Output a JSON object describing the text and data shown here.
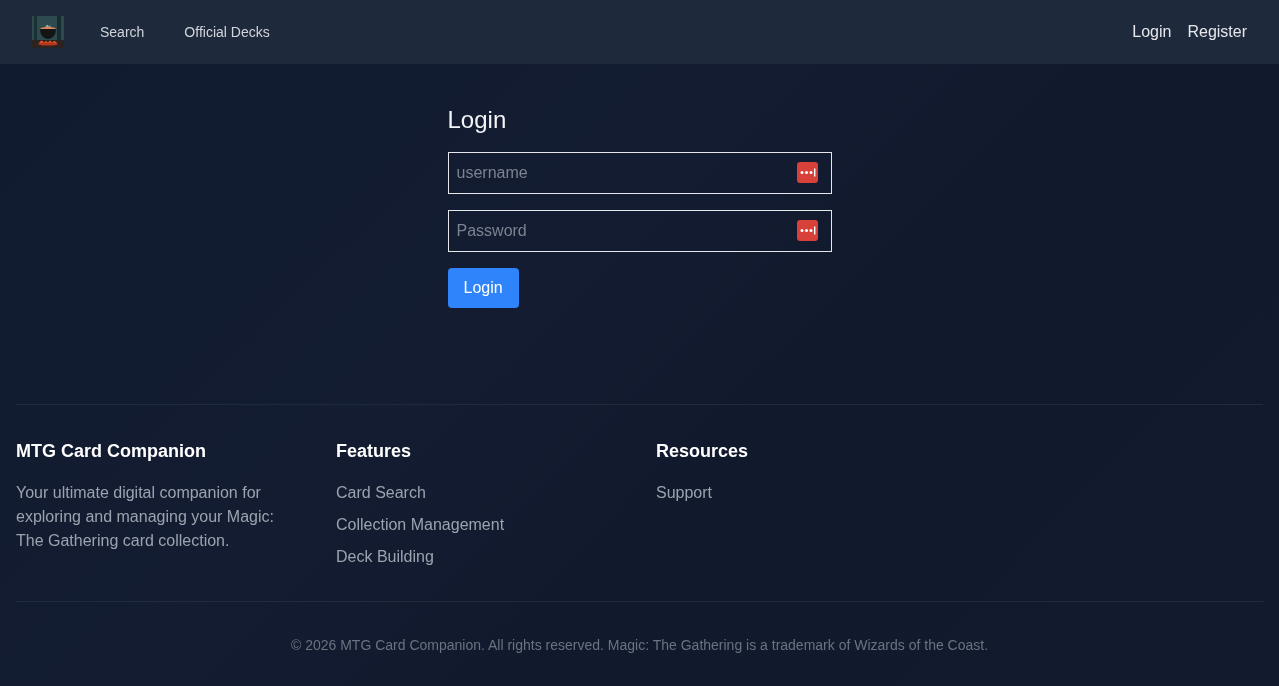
{
  "navbar": {
    "nav_links": [
      "Search",
      "Official Decks"
    ],
    "account_links": [
      "Login",
      "Register"
    ]
  },
  "login_form": {
    "title": "Login",
    "fields": [
      {
        "placeholder": "username"
      },
      {
        "placeholder": "Password"
      }
    ],
    "submit_button": "Login"
  },
  "footer": {
    "columns": [
      {
        "kind": "text",
        "title": "MTG Card Companion",
        "text": "Your ultimate digital companion for exploring and managing your Magic: The Gathering card collection."
      },
      {
        "kind": "links",
        "title": "Features",
        "links": [
          "Card Search",
          "Collection Management",
          "Deck Building"
        ]
      },
      {
        "kind": "links",
        "title": "Resources",
        "links": [
          "Support"
        ]
      }
    ],
    "copyright": "© 2026 MTG Card Companion. All rights reserved. Magic: The Gathering is a trademark of Wizards of the Coast."
  }
}
